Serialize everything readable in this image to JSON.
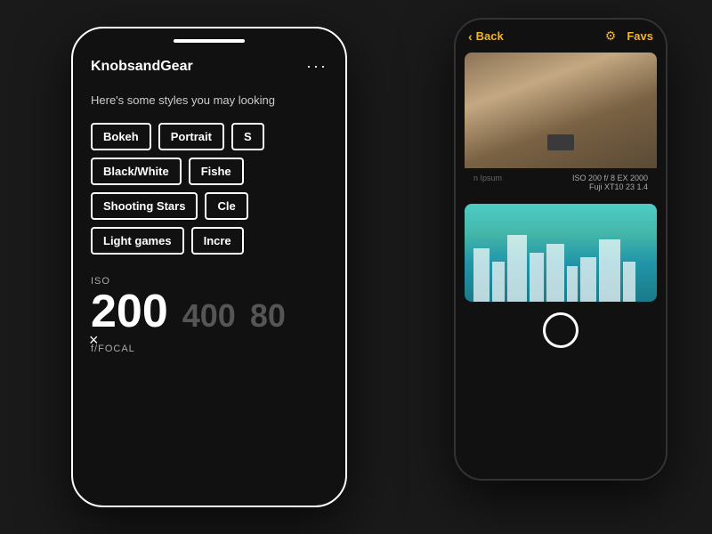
{
  "scene": {
    "background": "#1a1a1a"
  },
  "phone_left": {
    "app_title": "KnobsandGear",
    "more_dots": "···",
    "subtitle": "Here's some styles you may looking",
    "close_symbol": "×",
    "tags_row1": [
      "Bokeh",
      "Portrait",
      "S"
    ],
    "tags_row2": [
      "Black/White",
      "Fishe"
    ],
    "tags_row3": [
      "Shooting Stars",
      "Cle"
    ],
    "tags_row4": [
      "Light games",
      "Incre"
    ],
    "iso_label": "ISO",
    "iso_main": "200",
    "iso_dim1": "400",
    "iso_dim2": "80",
    "focal_label": "f/FOCAL"
  },
  "phone_right": {
    "back_label": "Back",
    "favs_label": "Favs",
    "photo1_lorem": "n Ipsum",
    "photo1_iso": "ISO 200 f/ 8 EX 2000",
    "photo1_lens": "Fuji XT10 23 1.4"
  }
}
